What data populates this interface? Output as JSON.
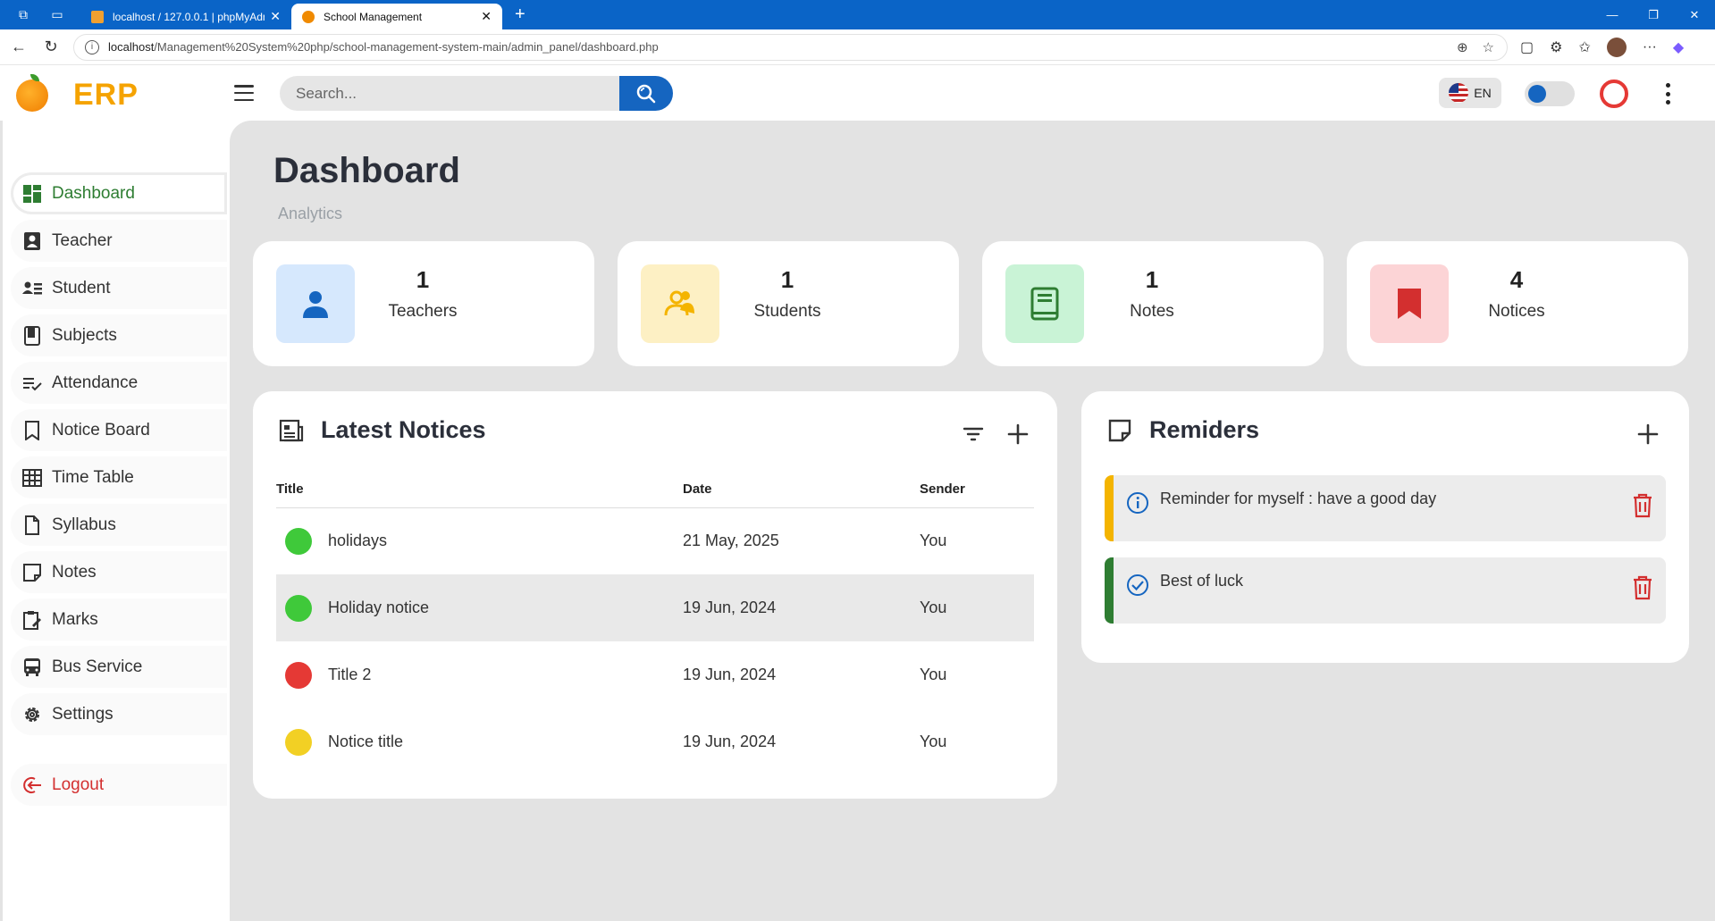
{
  "browser": {
    "tabs": [
      {
        "title": "localhost / 127.0.0.1 | phpMyAdm",
        "active": false
      },
      {
        "title": "School Management",
        "active": true
      }
    ],
    "url_host": "localhost",
    "url_path": "/Management%20System%20php/school-management-system-main/admin_panel/dashboard.php"
  },
  "app": {
    "logo": "ERP",
    "search_placeholder": "Search...",
    "language": "EN",
    "accent": "#1565c0"
  },
  "sidebar": {
    "items": [
      {
        "label": "Dashboard",
        "icon": "dashboard-icon",
        "active": true
      },
      {
        "label": "Teacher",
        "icon": "teacher-icon"
      },
      {
        "label": "Student",
        "icon": "student-icon"
      },
      {
        "label": "Subjects",
        "icon": "book-icon"
      },
      {
        "label": "Attendance",
        "icon": "checklist-icon"
      },
      {
        "label": "Notice Board",
        "icon": "bookmark-icon"
      },
      {
        "label": "Time Table",
        "icon": "table-icon"
      },
      {
        "label": "Syllabus",
        "icon": "file-icon"
      },
      {
        "label": "Notes",
        "icon": "note-icon"
      },
      {
        "label": "Marks",
        "icon": "clipboard-icon"
      },
      {
        "label": "Bus Service",
        "icon": "bus-icon"
      },
      {
        "label": "Settings",
        "icon": "gear-icon"
      }
    ],
    "logout": "Logout"
  },
  "page": {
    "title": "Dashboard",
    "subtitle": "Analytics"
  },
  "stats": [
    {
      "value": "1",
      "label": "Teachers",
      "icon": "person-icon",
      "bg": "#d6e8fd",
      "fg": "#1565c0"
    },
    {
      "value": "1",
      "label": "Students",
      "icon": "group-icon",
      "bg": "#fdf0c4",
      "fg": "#f4b400"
    },
    {
      "value": "1",
      "label": "Notes",
      "icon": "book-icon",
      "bg": "#c9f3d6",
      "fg": "#2e7d32"
    },
    {
      "value": "4",
      "label": "Notices",
      "icon": "bookmark-icon",
      "bg": "#fcd4d6",
      "fg": "#d32f2f"
    }
  ],
  "notices": {
    "title": "Latest Notices",
    "columns": [
      "Title",
      "Date",
      "Sender"
    ],
    "rows": [
      {
        "title": "holidays",
        "date": "21 May, 2025",
        "sender": "You",
        "status": "#3fc93a"
      },
      {
        "title": "Holiday notice",
        "date": "19 Jun, 2024",
        "sender": "You",
        "status": "#3fc93a"
      },
      {
        "title": "Title 2",
        "date": "19 Jun, 2024",
        "sender": "You",
        "status": "#e53935"
      },
      {
        "title": "Notice title",
        "date": "19 Jun, 2024",
        "sender": "You",
        "status": "#f2d024"
      }
    ]
  },
  "reminders": {
    "title": "Remiders",
    "items": [
      {
        "text": "Reminder for myself : have a good day",
        "color": "#f4b400",
        "icon": "info-icon"
      },
      {
        "text": "Best of luck",
        "color": "#2e7d32",
        "icon": "check-circle-icon"
      }
    ]
  }
}
